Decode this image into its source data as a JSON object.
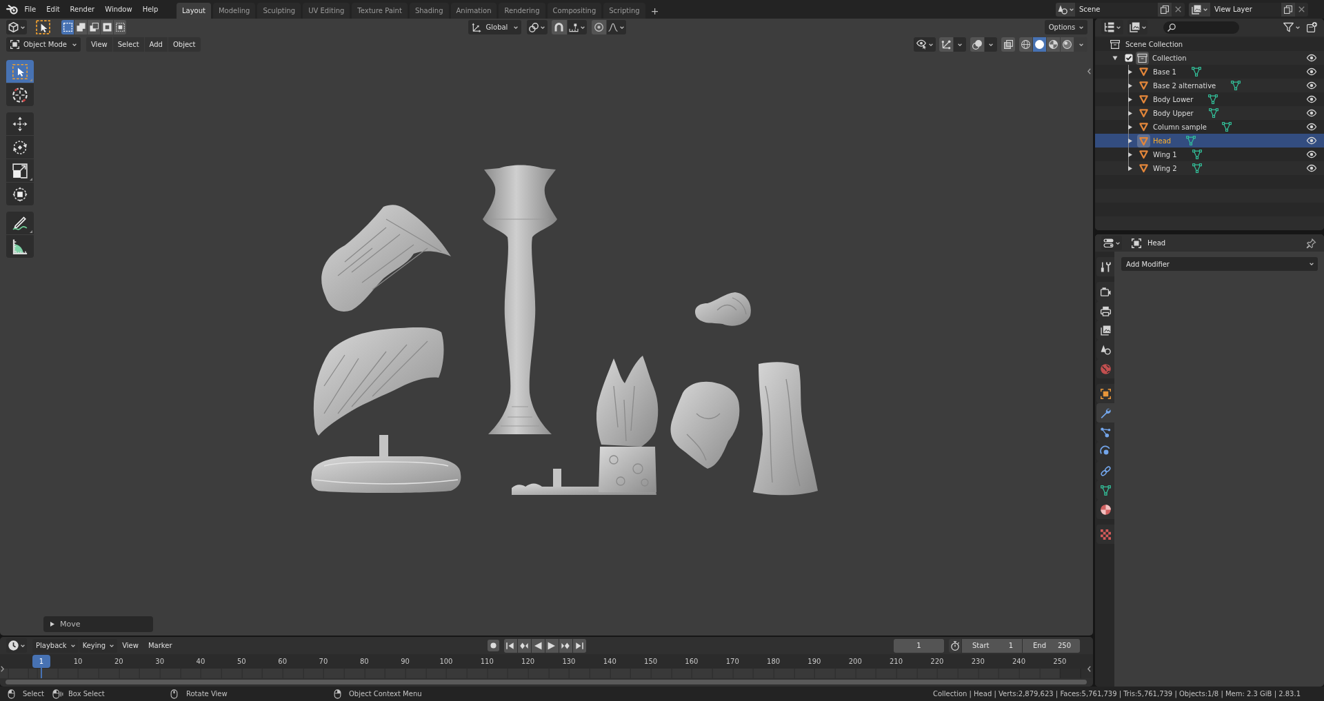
{
  "top_bar": {
    "menus": [
      "File",
      "Edit",
      "Render",
      "Window",
      "Help"
    ],
    "workspaces": [
      {
        "label": "Layout",
        "selected": true
      },
      {
        "label": "Modeling",
        "selected": false
      },
      {
        "label": "Sculpting",
        "selected": false
      },
      {
        "label": "UV Editing",
        "selected": false
      },
      {
        "label": "Texture Paint",
        "selected": false
      },
      {
        "label": "Shading",
        "selected": false
      },
      {
        "label": "Animation",
        "selected": false
      },
      {
        "label": "Rendering",
        "selected": false
      },
      {
        "label": "Compositing",
        "selected": false
      },
      {
        "label": "Scripting",
        "selected": false
      }
    ],
    "add_workspace": "+",
    "scene": "Scene",
    "view_layer": "View Layer"
  },
  "viewport": {
    "tool_settings": {
      "selection_modes": [
        {
          "kind": "set",
          "selected": true
        },
        {
          "kind": "extend",
          "selected": false
        },
        {
          "kind": "subtract",
          "selected": false
        },
        {
          "kind": "invert",
          "selected": false
        },
        {
          "kind": "intersect",
          "selected": false
        }
      ],
      "orientation": "Global",
      "snap": false,
      "proportional_editing": false,
      "options": "Options"
    },
    "header": {
      "mode": "Object Mode",
      "menus": [
        "View",
        "Select",
        "Add",
        "Object"
      ],
      "xray": false,
      "shading": [
        {
          "kind": "wireframe",
          "selected": false
        },
        {
          "kind": "solid",
          "selected": true
        },
        {
          "kind": "material",
          "selected": false
        },
        {
          "kind": "rendered",
          "selected": false
        }
      ]
    },
    "tools": [
      {
        "kind": "select",
        "selected": true
      },
      {
        "kind": "cursor",
        "selected": false
      },
      {
        "kind": "move",
        "selected": false
      },
      {
        "kind": "rotate",
        "selected": false
      },
      {
        "kind": "scale",
        "selected": false
      },
      {
        "kind": "transform",
        "selected": false
      },
      {
        "kind": "annotate",
        "selected": false
      },
      {
        "kind": "measure",
        "selected": false
      }
    ],
    "last_operation": {
      "label": "Move",
      "expanded": false
    }
  },
  "outliner": {
    "root": "Scene Collection",
    "collections": [
      {
        "label": "Collection",
        "checked": true,
        "active": true,
        "expanded": true,
        "children": [
          {
            "label": "Base 1",
            "selected": false,
            "expanded": false
          },
          {
            "label": "Base 2 alternative",
            "selected": false,
            "expanded": false
          },
          {
            "label": "Body Lower",
            "selected": false,
            "expanded": false
          },
          {
            "label": "Body Upper",
            "selected": false,
            "expanded": false
          },
          {
            "label": "Column sample",
            "selected": false,
            "expanded": false
          },
          {
            "label": "Head",
            "selected": true,
            "expanded": false
          },
          {
            "label": "Wing 1",
            "selected": false,
            "expanded": false
          },
          {
            "label": "Wing 2",
            "selected": false,
            "expanded": false
          }
        ]
      }
    ]
  },
  "properties": {
    "object": "Head",
    "tabs": [
      {
        "kind": "tool",
        "selected": false
      },
      {
        "kind": "render",
        "selected": false
      },
      {
        "kind": "output",
        "selected": false
      },
      {
        "kind": "viewlayer",
        "selected": false
      },
      {
        "kind": "scene",
        "selected": false
      },
      {
        "kind": "world",
        "selected": false
      },
      {
        "kind": "object",
        "selected": false
      },
      {
        "kind": "modifiers",
        "selected": true
      },
      {
        "kind": "particles",
        "selected": false
      },
      {
        "kind": "physics",
        "selected": false
      },
      {
        "kind": "constraints",
        "selected": false
      },
      {
        "kind": "data",
        "selected": false
      },
      {
        "kind": "material",
        "selected": false
      },
      {
        "kind": "texture",
        "selected": false
      }
    ],
    "add_modifier": "Add Modifier"
  },
  "timeline": {
    "menus": [
      {
        "label": "Playback",
        "kind": "dropdown"
      },
      {
        "label": "Keying",
        "kind": "dropdown"
      },
      {
        "label": "View",
        "kind": "menu"
      },
      {
        "label": "Marker",
        "kind": "menu"
      }
    ],
    "auto_keying": false,
    "current_frame": "1",
    "start": {
      "label": "Start",
      "value": "1"
    },
    "end": {
      "label": "End",
      "value": "250"
    },
    "ruler": {
      "current": "1",
      "labels": [
        "10",
        "20",
        "30",
        "40",
        "50",
        "60",
        "70",
        "80",
        "90",
        "100",
        "110",
        "120",
        "130",
        "140",
        "150",
        "160",
        "170",
        "180",
        "190",
        "200",
        "210",
        "220",
        "230",
        "240",
        "250"
      ]
    }
  },
  "status_bar": {
    "hints": [
      {
        "kind": "left",
        "label": "Select"
      },
      {
        "kind": "drag",
        "label": "Box Select"
      },
      {
        "kind": "middle",
        "label": "Rotate View"
      },
      {
        "kind": "right",
        "label": "Object Context Menu"
      }
    ],
    "stats": "Collection | Head | Verts:2,879,623 | Faces:5,761,739 | Tris:5,761,739 | Objects:1/8 | Mem: 2.3 GiB | 2.83.1"
  }
}
